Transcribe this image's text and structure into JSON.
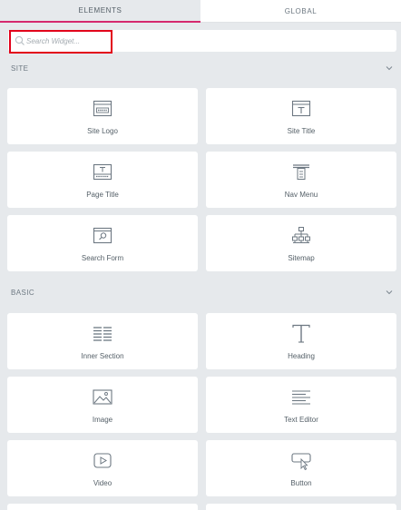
{
  "tabs": [
    {
      "label": "ELEMENTS",
      "active": true
    },
    {
      "label": "GLOBAL",
      "active": false
    }
  ],
  "search": {
    "placeholder": "Search Widget..."
  },
  "sections": [
    {
      "title": "SITE",
      "widgets": [
        {
          "label": "Site Logo",
          "icon": "site-logo-icon"
        },
        {
          "label": "Site Title",
          "icon": "site-title-icon"
        },
        {
          "label": "Page Title",
          "icon": "page-title-icon"
        },
        {
          "label": "Nav Menu",
          "icon": "nav-menu-icon"
        },
        {
          "label": "Search Form",
          "icon": "search-form-icon"
        },
        {
          "label": "Sitemap",
          "icon": "sitemap-icon"
        }
      ]
    },
    {
      "title": "BASIC",
      "widgets": [
        {
          "label": "Inner Section",
          "icon": "inner-section-icon"
        },
        {
          "label": "Heading",
          "icon": "heading-icon"
        },
        {
          "label": "Image",
          "icon": "image-icon"
        },
        {
          "label": "Text Editor",
          "icon": "text-editor-icon"
        },
        {
          "label": "Video",
          "icon": "video-icon"
        },
        {
          "label": "Button",
          "icon": "button-icon"
        }
      ]
    }
  ],
  "colors": {
    "accent": "#d5296e",
    "highlight": "#e2001a",
    "panel_bg": "#e6e9ec"
  }
}
